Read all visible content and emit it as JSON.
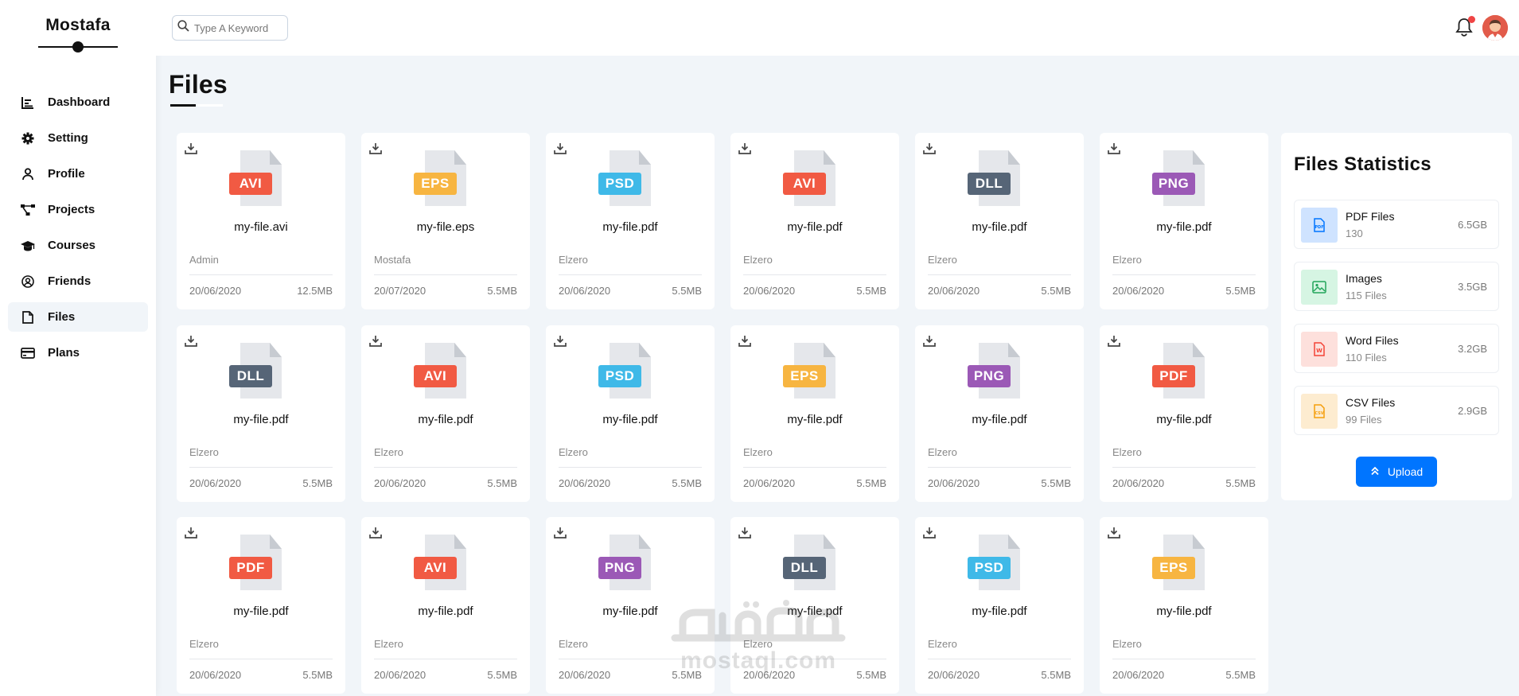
{
  "sidebar": {
    "brand": "Mostafa",
    "items": [
      {
        "label": "Dashboard",
        "icon": "chart-icon",
        "active": false
      },
      {
        "label": "Setting",
        "icon": "gear-icon",
        "active": false
      },
      {
        "label": "Profile",
        "icon": "user-icon",
        "active": false
      },
      {
        "label": "Projects",
        "icon": "diagram-icon",
        "active": false
      },
      {
        "label": "Courses",
        "icon": "graduation-cap-icon",
        "active": false
      },
      {
        "label": "Friends",
        "icon": "user-circle-icon",
        "active": false
      },
      {
        "label": "Files",
        "icon": "file-icon",
        "active": true
      },
      {
        "label": "Plans",
        "icon": "credit-card-icon",
        "active": false
      }
    ]
  },
  "header": {
    "search_placeholder": "Type A Keyword"
  },
  "page": {
    "title": "Files"
  },
  "files": [
    {
      "tag": "AVI",
      "color": "#f15a43",
      "name": "my-file.avi",
      "owner": "Admin",
      "date": "20/06/2020",
      "size": "12.5MB"
    },
    {
      "tag": "EPS",
      "color": "#f7b541",
      "name": "my-file.eps",
      "owner": "Mostafa",
      "date": "20/07/2020",
      "size": "5.5MB"
    },
    {
      "tag": "PSD",
      "color": "#3fb9e8",
      "name": "my-file.pdf",
      "owner": "Elzero",
      "date": "20/06/2020",
      "size": "5.5MB"
    },
    {
      "tag": "AVI",
      "color": "#f15a43",
      "name": "my-file.pdf",
      "owner": "Elzero",
      "date": "20/06/2020",
      "size": "5.5MB"
    },
    {
      "tag": "DLL",
      "color": "#566577",
      "name": "my-file.pdf",
      "owner": "Elzero",
      "date": "20/06/2020",
      "size": "5.5MB"
    },
    {
      "tag": "PNG",
      "color": "#9b59b6",
      "name": "my-file.pdf",
      "owner": "Elzero",
      "date": "20/06/2020",
      "size": "5.5MB"
    },
    {
      "tag": "DLL",
      "color": "#566577",
      "name": "my-file.pdf",
      "owner": "Elzero",
      "date": "20/06/2020",
      "size": "5.5MB"
    },
    {
      "tag": "AVI",
      "color": "#f15a43",
      "name": "my-file.pdf",
      "owner": "Elzero",
      "date": "20/06/2020",
      "size": "5.5MB"
    },
    {
      "tag": "PSD",
      "color": "#3fb9e8",
      "name": "my-file.pdf",
      "owner": "Elzero",
      "date": "20/06/2020",
      "size": "5.5MB"
    },
    {
      "tag": "EPS",
      "color": "#f7b541",
      "name": "my-file.pdf",
      "owner": "Elzero",
      "date": "20/06/2020",
      "size": "5.5MB"
    },
    {
      "tag": "PNG",
      "color": "#9b59b6",
      "name": "my-file.pdf",
      "owner": "Elzero",
      "date": "20/06/2020",
      "size": "5.5MB"
    },
    {
      "tag": "PDF",
      "color": "#f15a43",
      "name": "my-file.pdf",
      "owner": "Elzero",
      "date": "20/06/2020",
      "size": "5.5MB"
    },
    {
      "tag": "PDF",
      "color": "#f15a43",
      "name": "my-file.pdf",
      "owner": "Elzero",
      "date": "20/06/2020",
      "size": "5.5MB"
    },
    {
      "tag": "AVI",
      "color": "#f15a43",
      "name": "my-file.pdf",
      "owner": "Elzero",
      "date": "20/06/2020",
      "size": "5.5MB"
    },
    {
      "tag": "PNG",
      "color": "#9b59b6",
      "name": "my-file.pdf",
      "owner": "Elzero",
      "date": "20/06/2020",
      "size": "5.5MB"
    },
    {
      "tag": "DLL",
      "color": "#566577",
      "name": "my-file.pdf",
      "owner": "Elzero",
      "date": "20/06/2020",
      "size": "5.5MB"
    },
    {
      "tag": "PSD",
      "color": "#3fb9e8",
      "name": "my-file.pdf",
      "owner": "Elzero",
      "date": "20/06/2020",
      "size": "5.5MB"
    },
    {
      "tag": "EPS",
      "color": "#f7b541",
      "name": "my-file.pdf",
      "owner": "Elzero",
      "date": "20/06/2020",
      "size": "5.5MB"
    }
  ],
  "stats": {
    "title": "Files Statistics",
    "items": [
      {
        "name": "PDF Files",
        "sub": "130",
        "size": "6.5GB",
        "bg": "#cfe3ff",
        "fg": "#0075ff",
        "icon": "pdf-file-icon"
      },
      {
        "name": "Images",
        "sub": "115 Files",
        "size": "3.5GB",
        "bg": "#d6f5e3",
        "fg": "#22a55a",
        "icon": "image-icon"
      },
      {
        "name": "Word Files",
        "sub": "110 Files",
        "size": "3.2GB",
        "bg": "#fde0dc",
        "fg": "#f44336",
        "icon": "word-file-icon"
      },
      {
        "name": "CSV Files",
        "sub": "99 Files",
        "size": "2.9GB",
        "bg": "#fdecd0",
        "fg": "#f59e0b",
        "icon": "csv-file-icon"
      }
    ],
    "upload_label": "Upload"
  },
  "watermark": {
    "text": "mostaql.com"
  }
}
